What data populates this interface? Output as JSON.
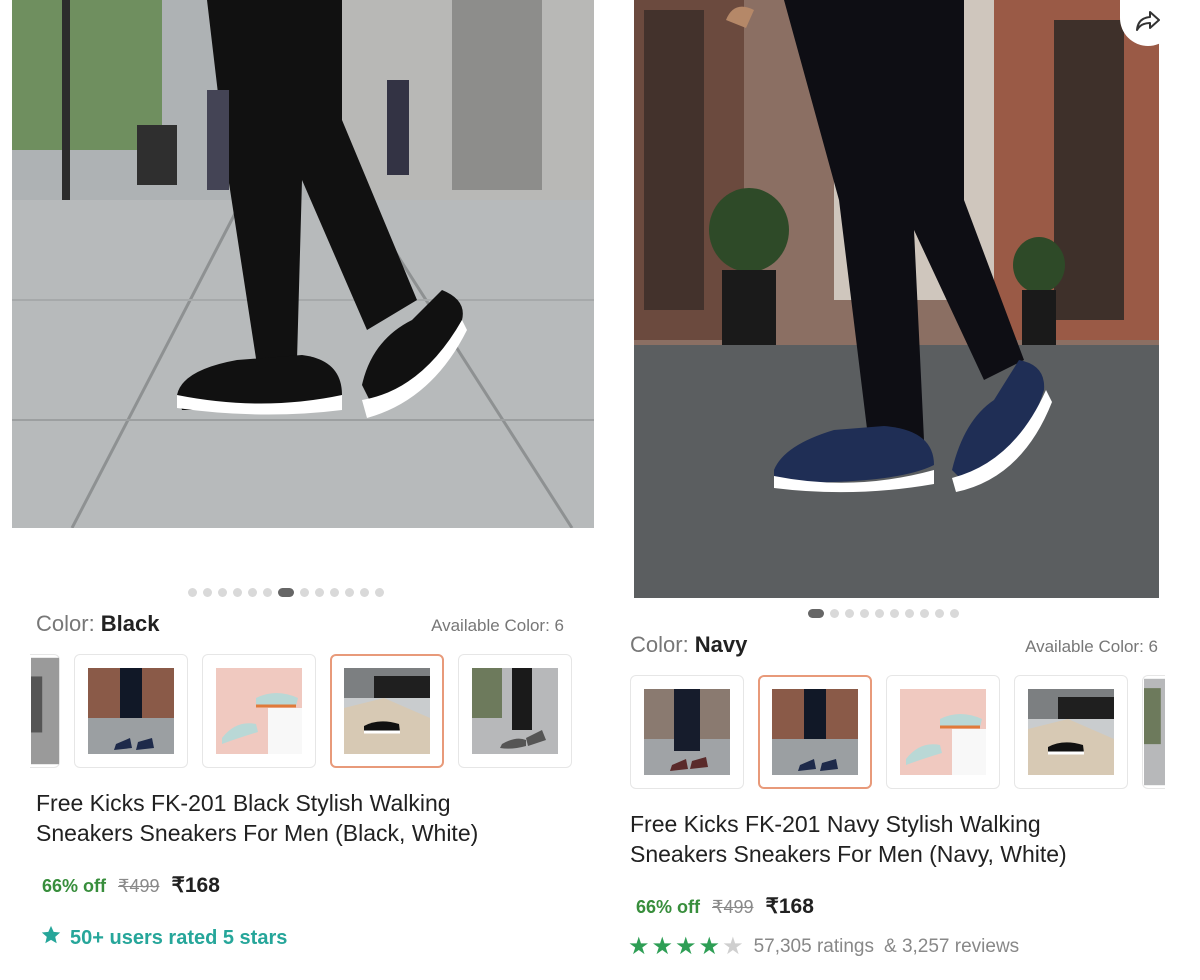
{
  "left": {
    "color_prefix": "Color: ",
    "color_value": "Black",
    "available": "Available Color: 6",
    "title_line1": "Free Kicks FK-201 Black Stylish Walking",
    "title_line2": "Sneakers Sneakers For Men (Black, White)",
    "discount": "66% off",
    "mrp": "₹499",
    "price": "₹168",
    "rated": "50+ users rated 5 stars",
    "carousel_total": 13,
    "carousel_active": 6
  },
  "right": {
    "color_prefix": "Color: ",
    "color_value": "Navy",
    "available": "Available Color: 6",
    "title_line1": "Free Kicks FK-201 Navy Stylish Walking",
    "title_line2": "Sneakers Sneakers For Men (Navy, White)",
    "discount": "66% off",
    "mrp": "₹499",
    "price": "₹168",
    "rating_stars": 4,
    "ratings": "57,305 ratings",
    "reviews": "& 3,257 reviews",
    "carousel_total": 10,
    "carousel_active": 0
  },
  "colors": {
    "green": "#388e3c",
    "teal": "#26a69a",
    "selected_border": "#e89a7a",
    "star": "#2e9e55"
  },
  "icons": [
    "share-icon",
    "star-icon"
  ]
}
